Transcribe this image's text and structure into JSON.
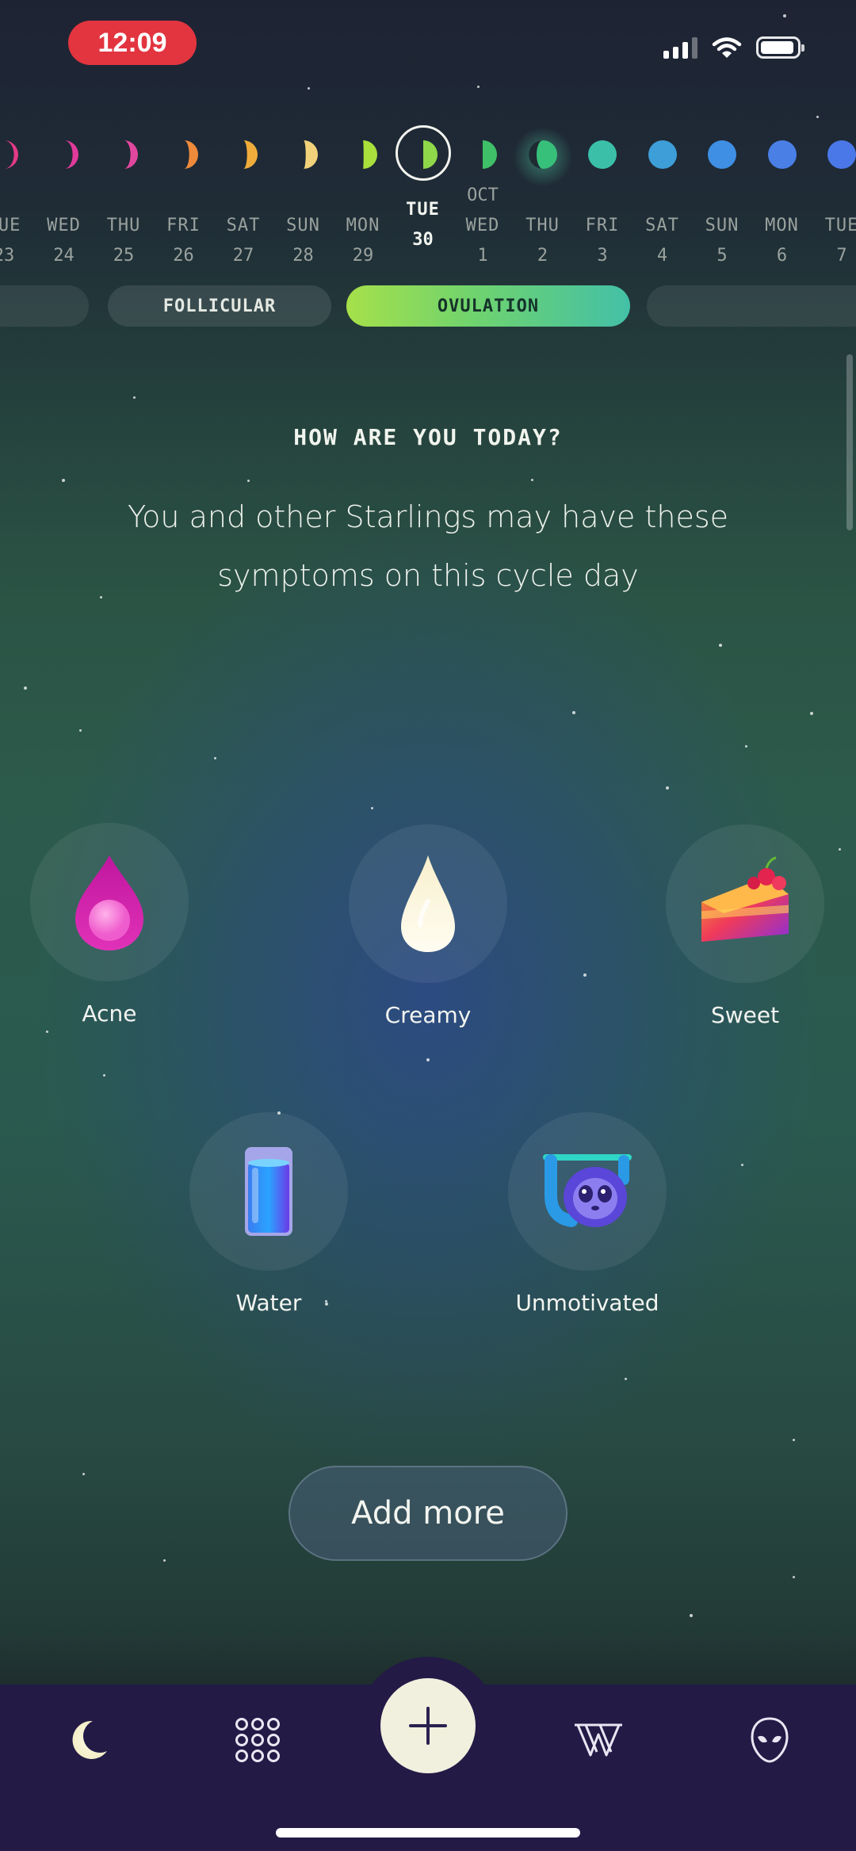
{
  "status_bar": {
    "time": "12:09"
  },
  "calendar": {
    "month_label": "OCT",
    "days": [
      {
        "dow": "TUE",
        "num": "23"
      },
      {
        "dow": "WED",
        "num": "24"
      },
      {
        "dow": "THU",
        "num": "25"
      },
      {
        "dow": "FRI",
        "num": "26"
      },
      {
        "dow": "SAT",
        "num": "27"
      },
      {
        "dow": "SUN",
        "num": "28"
      },
      {
        "dow": "MON",
        "num": "29"
      },
      {
        "dow": "TUE",
        "num": "30"
      },
      {
        "dow": "WED",
        "num": "1"
      },
      {
        "dow": "THU",
        "num": "2"
      },
      {
        "dow": "FRI",
        "num": "3"
      },
      {
        "dow": "SAT",
        "num": "4"
      },
      {
        "dow": "SUN",
        "num": "5"
      },
      {
        "dow": "MON",
        "num": "6"
      },
      {
        "dow": "TUE",
        "num": "7"
      }
    ],
    "moon_colors": [
      "#e23a86",
      "#e03a9a",
      "#e2479e",
      "#ee8a3a",
      "#f0ac3a",
      "#f1d27a",
      "#a9e03c",
      "#8fd84a",
      "#3fbf68",
      "#37c07a",
      "#3bbfa8",
      "#3e9ed8",
      "#3f8fe4",
      "#4a7fe6",
      "#4b78e8"
    ],
    "today_index": 7
  },
  "phases": {
    "follicular": "FOLLICULAR",
    "ovulation": "OVULATION"
  },
  "question": {
    "title": "HOW ARE YOU TODAY?",
    "subtitle": "You and other Starlings may have these symptoms on this cycle day"
  },
  "symptoms": [
    {
      "label": "Acne",
      "icon": "acne-drop-icon"
    },
    {
      "label": "Creamy",
      "icon": "creamy-drop-icon"
    },
    {
      "label": "Sweet",
      "icon": "cake-slice-icon"
    },
    {
      "label": "Water",
      "icon": "water-glass-icon"
    },
    {
      "label": "Unmotivated",
      "icon": "sloth-icon"
    }
  ],
  "add_more_label": "Add more",
  "nav": {
    "items": [
      "moon-icon",
      "grid-icon",
      "plus-icon",
      "wiki-icon",
      "alien-icon"
    ]
  }
}
